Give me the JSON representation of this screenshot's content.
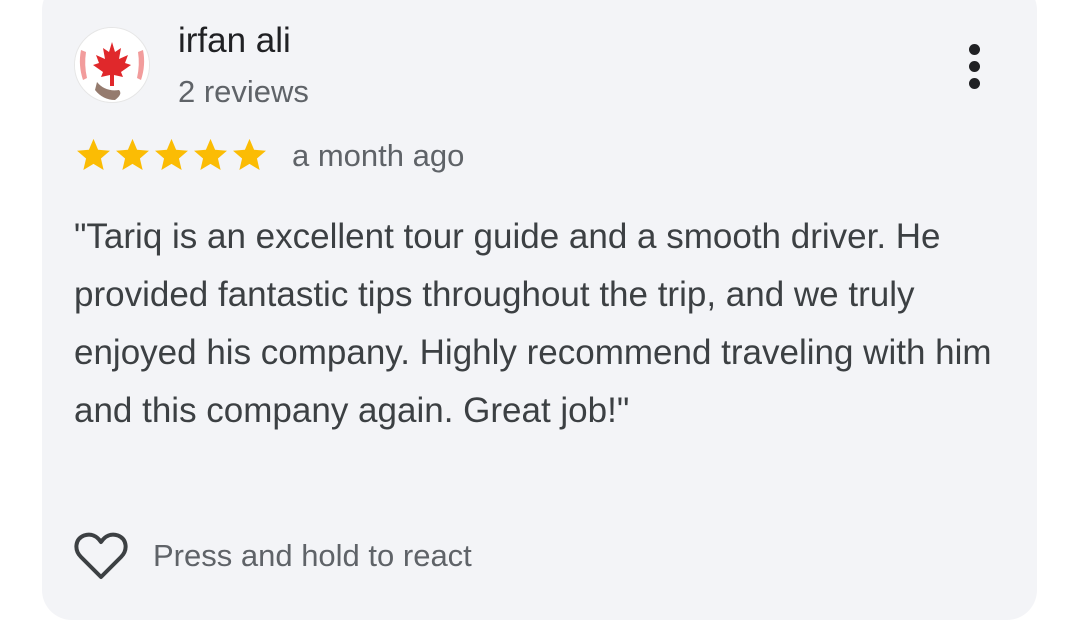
{
  "review": {
    "author_name": "irfan ali",
    "author_reviews": "2 reviews",
    "avatar_icon": "maple-leaf-icon",
    "rating": 5,
    "rating_max": 5,
    "star_color": "#fbbc04",
    "time": "a month ago",
    "text": "\"Tariq is an excellent tour guide and a smooth driver. He provided fantastic tips throughout the trip, and we truly enjoyed his company. Highly recommend traveling with him and this company again. Great job!\"",
    "more_icon": "more-vertical-icon"
  },
  "react": {
    "icon": "heart-outline-icon",
    "label": "Press and hold to react"
  },
  "colors": {
    "card_background": "#f3f4f7",
    "primary_text": "#202124",
    "secondary_text": "#5f6368"
  }
}
